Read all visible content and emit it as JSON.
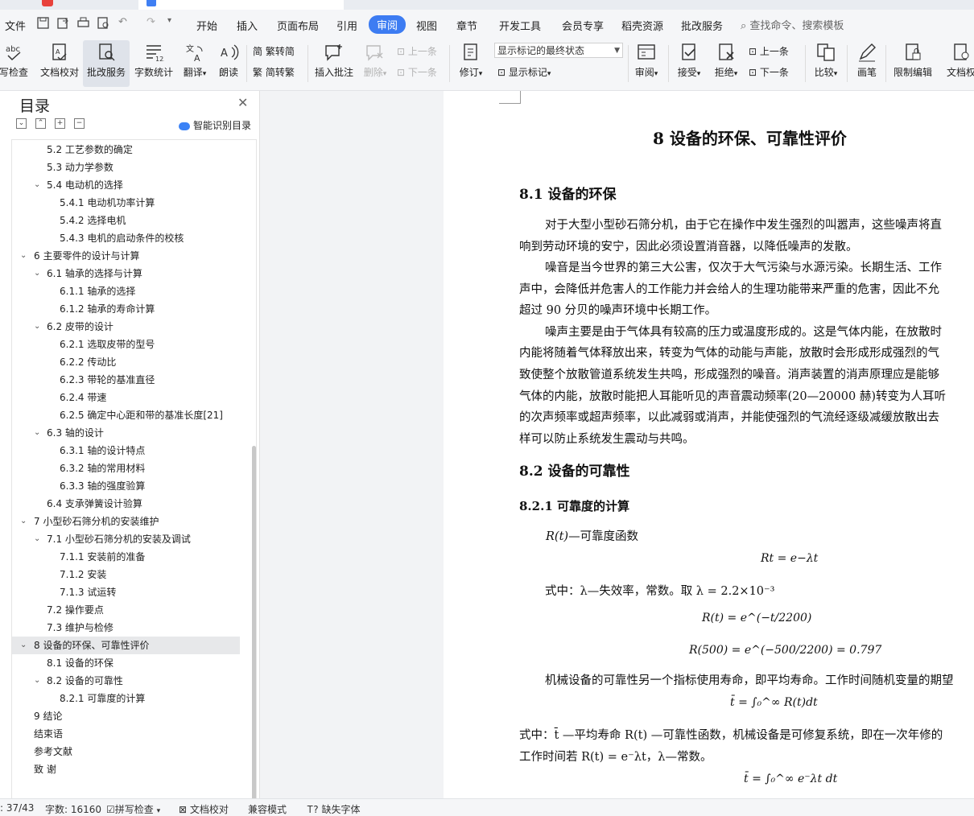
{
  "menu": {
    "items": [
      "文件",
      "开始",
      "插入",
      "页面布局",
      "引用",
      "审阅",
      "视图",
      "章节",
      "开发工具",
      "会员专享",
      "稻壳资源",
      "批改服务"
    ],
    "active": "审阅",
    "search_placeholder": "查找命令、搜索模板"
  },
  "ribbon": {
    "spellcheck": "拼写检查",
    "proofread": "文档校对",
    "correction_service": "批改服务",
    "word_count": "字数统计",
    "translate": "翻译",
    "read_aloud": "朗读",
    "trad_to_simp": "繁转简",
    "simp_to_trad": "简转繁",
    "insert_comment": "插入批注",
    "delete": "删除",
    "prev_comment": "上一条",
    "next_comment": "下一条",
    "revise": "修订",
    "markup_mode": "显示标记的最终状态",
    "show_markup": "显示标记",
    "review": "审阅",
    "accept": "接受",
    "reject": "拒绝",
    "prev_change": "上一条",
    "next_change": "下一条",
    "compare": "比较",
    "ink": "画笔",
    "restrict_edit": "限制编辑",
    "doc_permission": "文档权"
  },
  "nav": {
    "title": "目录",
    "smart_toc": "智能识别目录",
    "items": [
      {
        "text": "5.2 工艺参数的确定",
        "level": 2,
        "toggle": ""
      },
      {
        "text": "5.3 动力学参数",
        "level": 2,
        "toggle": ""
      },
      {
        "text": "5.4 电动机的选择",
        "level": 2,
        "toggle": "v"
      },
      {
        "text": "5.4.1 电动机功率计算",
        "level": 3,
        "toggle": ""
      },
      {
        "text": "5.4.2 选择电机",
        "level": 3,
        "toggle": ""
      },
      {
        "text": "5.4.3 电机的启动条件的校核",
        "level": 3,
        "toggle": ""
      },
      {
        "text": "6   主要零件的设计与计算",
        "level": 1,
        "toggle": "v"
      },
      {
        "text": "6.1 轴承的选择与计算",
        "level": 2,
        "toggle": "v"
      },
      {
        "text": "6.1.1 轴承的选择",
        "level": 3,
        "toggle": ""
      },
      {
        "text": "6.1.2 轴承的寿命计算",
        "level": 3,
        "toggle": ""
      },
      {
        "text": "6.2 皮带的设计",
        "level": 2,
        "toggle": "v"
      },
      {
        "text": "6.2.1 选取皮带的型号",
        "level": 3,
        "toggle": ""
      },
      {
        "text": "6.2.2 传动比",
        "level": 3,
        "toggle": ""
      },
      {
        "text": "6.2.3 带轮的基准直径",
        "level": 3,
        "toggle": ""
      },
      {
        "text": "6.2.4 带速",
        "level": 3,
        "toggle": ""
      },
      {
        "text": "6.2.5 确定中心距和带的基准长度[21]",
        "level": 3,
        "toggle": ""
      },
      {
        "text": "6.3 轴的设计",
        "level": 2,
        "toggle": "v"
      },
      {
        "text": "6.3.1 轴的设计特点",
        "level": 3,
        "toggle": ""
      },
      {
        "text": "6.3.2 轴的常用材料",
        "level": 3,
        "toggle": ""
      },
      {
        "text": "6.3.3 轴的强度验算",
        "level": 3,
        "toggle": ""
      },
      {
        "text": "6.4 支承弹簧设计验算",
        "level": 2,
        "toggle": ""
      },
      {
        "text": "7   小型砂石筛分机的安装维护",
        "level": 1,
        "toggle": "v"
      },
      {
        "text": "7.1 小型砂石筛分机的安装及调试",
        "level": 2,
        "toggle": "v"
      },
      {
        "text": "7.1.1 安装前的准备",
        "level": 3,
        "toggle": ""
      },
      {
        "text": "7.1.2 安装",
        "level": 3,
        "toggle": ""
      },
      {
        "text": "7.1.3 试运转",
        "level": 3,
        "toggle": ""
      },
      {
        "text": "7.2 操作要点",
        "level": 2,
        "toggle": ""
      },
      {
        "text": "7.3 维护与检修",
        "level": 2,
        "toggle": ""
      },
      {
        "text": "8   设备的环保、可靠性评价",
        "level": 1,
        "toggle": "v",
        "selected": true
      },
      {
        "text": "8.1 设备的环保",
        "level": 2,
        "toggle": ""
      },
      {
        "text": "8.2 设备的可靠性",
        "level": 2,
        "toggle": "v"
      },
      {
        "text": "8.2.1 可靠度的计算",
        "level": 3,
        "toggle": ""
      },
      {
        "text": "9   结论",
        "level": 1,
        "toggle": ""
      },
      {
        "text": "结束语",
        "level": 1,
        "toggle": ""
      },
      {
        "text": "参考文献",
        "level": 1,
        "toggle": ""
      },
      {
        "text": "致   谢",
        "level": 1,
        "toggle": ""
      }
    ]
  },
  "doc": {
    "chapter_title": "8    设备的环保、可靠性评价",
    "s81_title": "8.1 设备的环保",
    "para1_l1": "对于大型小型砂石筛分机，由于它在操作中发生强烈的叫嚣声，这些噪声将直",
    "para1_l2": "响到劳动环境的安宁，因此必须设置消音器，以降低噪声的发散。",
    "para2_l1": "噪音是当今世界的第三大公害，仅次于大气污染与水源污染。长期生活、工作",
    "para2_l2": "声中，会降低并危害人的工作能力并会给人的生理功能带来严重的危害，因此不允",
    "para2_l3": "超过 90 分贝的噪声环境中长期工作。",
    "para3_l1": "噪声主要是由于气体具有较高的压力或温度形成的。这是气体内能，在放散时",
    "para3_l2": "内能将随着气体释放出来，转变为气体的动能与声能，放散时会形成形成强烈的气",
    "para3_l3": "致使整个放散管道系统发生共鸣，形成强烈的噪音。消声装置的消声原理应是能够",
    "para3_l4": "气体的内能，放散时能把人耳能听见的声音震动频率(20—20000 赫)转变为人耳听",
    "para3_l5": "的次声频率或超声频率，以此减弱或消声，并能使强烈的气流经逐级减缓放散出去",
    "para3_l6": "样可以防止系统发生震动与共鸣。",
    "s82_title": "8.2 设备的可靠性",
    "s821_title": "8.2.1 可靠度的计算",
    "rt_def_sym": "R(t)",
    "rt_def_text": "—可靠度函数",
    "eq1": "Rt = e−λt",
    "lambda_line": "式中：λ—失效率，常数。取 λ = 2.2×10⁻³",
    "eq2": "R(t) = e^(−t/2200)",
    "eq3": "R(500) = e^(−500/2200) = 0.797",
    "para4": "机械设备的可靠性另一个指标使用寿命，即平均寿命。工作时间随机变量的期望",
    "eq4": "t̄ = ∫₀^∞ R(t)dt",
    "para5_l1": "式中：t̄ —平均寿命 R(t) —可靠性函数，机械设备是可修复系统，即在一次年修的",
    "para5_l2": "工作时间若 R(t) = e⁻λt，λ—常数。",
    "eq5": "t̄ = ∫₀^∞ e⁻λt dt"
  },
  "status": {
    "page": ": 37/43",
    "words": "字数: 16160",
    "spell": "拼写检查",
    "proof": "文档校对",
    "compat": "兼容模式",
    "missing_font": "缺失字体"
  }
}
